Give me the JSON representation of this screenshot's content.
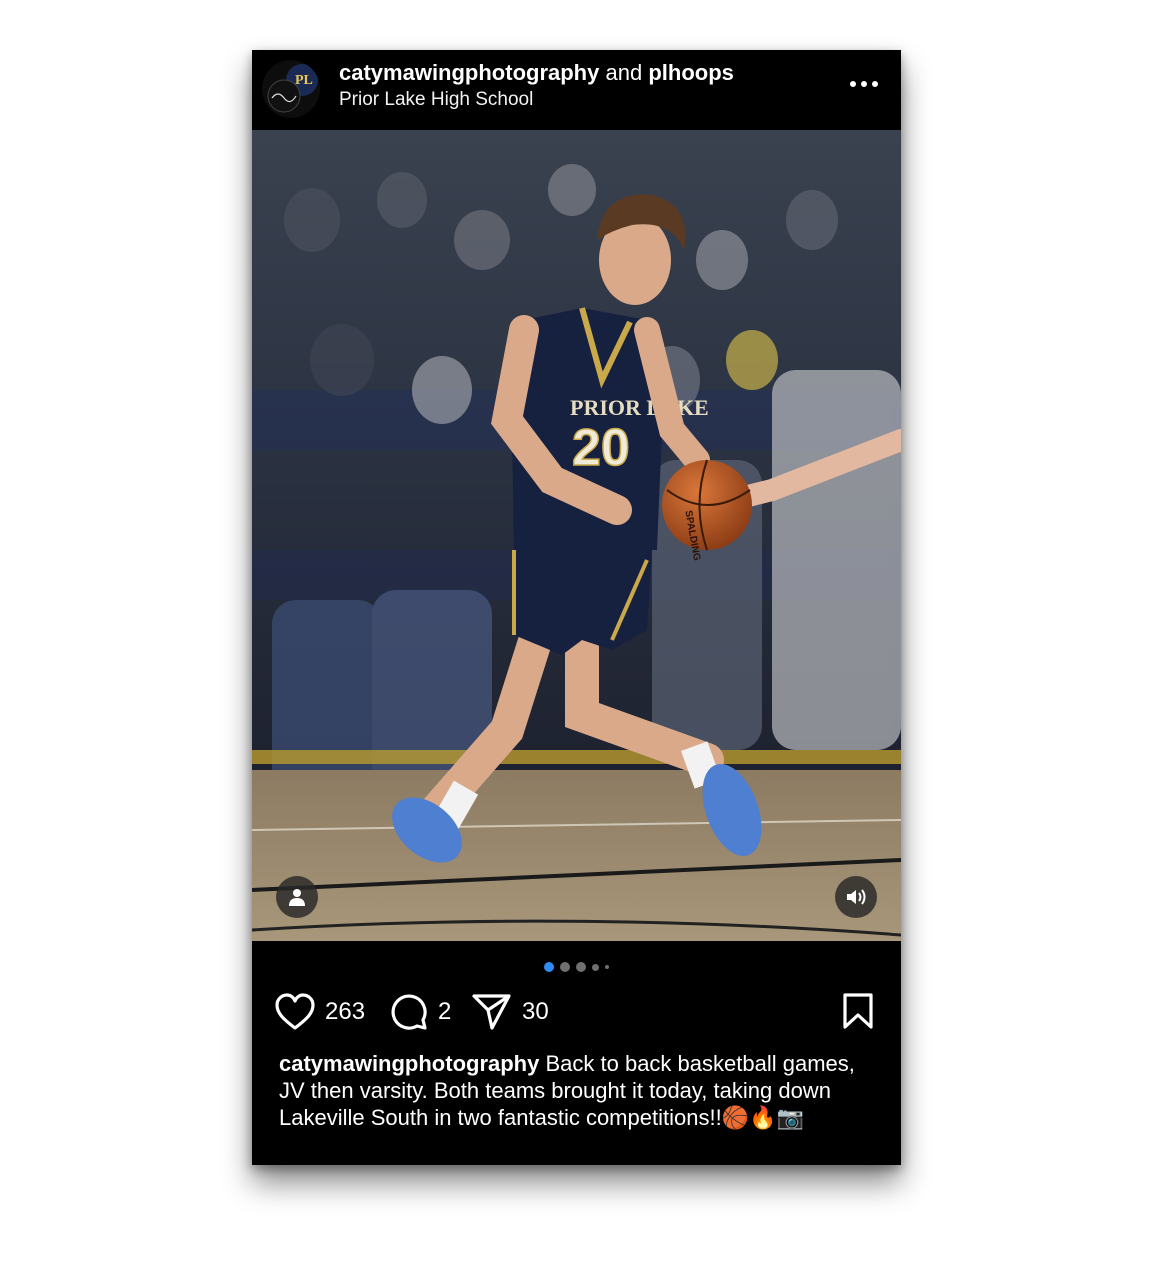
{
  "post": {
    "author": "catymawingphotography",
    "connector": "and",
    "collaborator": "plhoops",
    "location": "Prior Lake High School",
    "avatar_text": "PL",
    "more_icon": "more-horizontal-icon"
  },
  "photo": {
    "jersey_text": "PRIOR LAKE",
    "jersey_number": "20",
    "ball_brand": "SPALDING",
    "carousel": {
      "count": 5,
      "active_index": 0
    }
  },
  "stats": {
    "likes": "263",
    "comments": "2",
    "shares": "30"
  },
  "caption": {
    "username": "catymawingphotography",
    "text": "Back to back basketball games, JV then varsity. Both teams brought it today, taking down Lakeville South in two fantastic competitions!!🏀🔥📷"
  },
  "colors": {
    "background": "#000000",
    "accent_dot": "#2f8cf0",
    "jersey_navy": "#16203f",
    "jersey_gold": "#c9a94a"
  }
}
